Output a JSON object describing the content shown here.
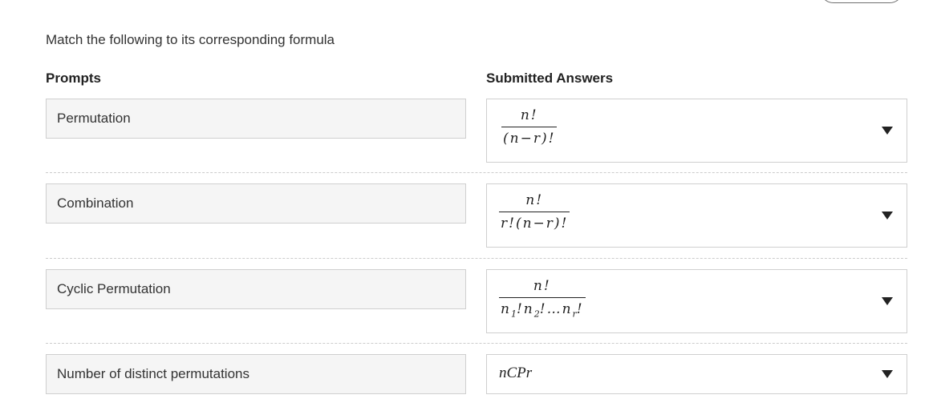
{
  "instruction": "Match the following to its corresponding formula",
  "headers": {
    "prompts": "Prompts",
    "answers": "Submitted Answers"
  },
  "rows": [
    {
      "prompt": "Permutation",
      "answer": {
        "numerator": "n!",
        "denominator": "(n−r)!"
      }
    },
    {
      "prompt": "Combination",
      "answer": {
        "numerator": "n!",
        "denominator": "r!(n−r)!"
      }
    },
    {
      "prompt": "Cyclic Permutation",
      "answer": {
        "numerator": "n!",
        "denominator_parts": [
          "n",
          "1",
          "!n",
          "2",
          "!…n",
          "r",
          "!"
        ]
      }
    },
    {
      "prompt": "Number of distinct permutations",
      "answer": {
        "text": "nCPr"
      }
    }
  ]
}
